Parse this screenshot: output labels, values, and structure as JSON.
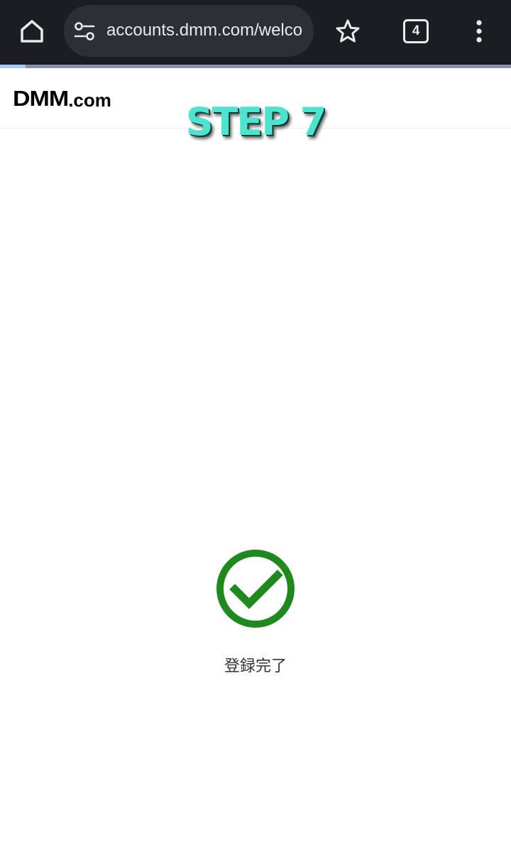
{
  "browser": {
    "url": "accounts.dmm.com/welco",
    "tab_count": "4",
    "page_load_progress": 0.05
  },
  "site": {
    "logo_main": "DMM",
    "logo_suffix": ".com"
  },
  "overlay": {
    "step_label": "STEP 7"
  },
  "main": {
    "status_text": "登録完了",
    "status_icon": "check-circle-icon"
  },
  "colors": {
    "browser_bg": "#1b1d22",
    "omnibox_bg": "#2c2f36",
    "success_green": "#1e8a1e",
    "step_text": "#4de3cf"
  }
}
